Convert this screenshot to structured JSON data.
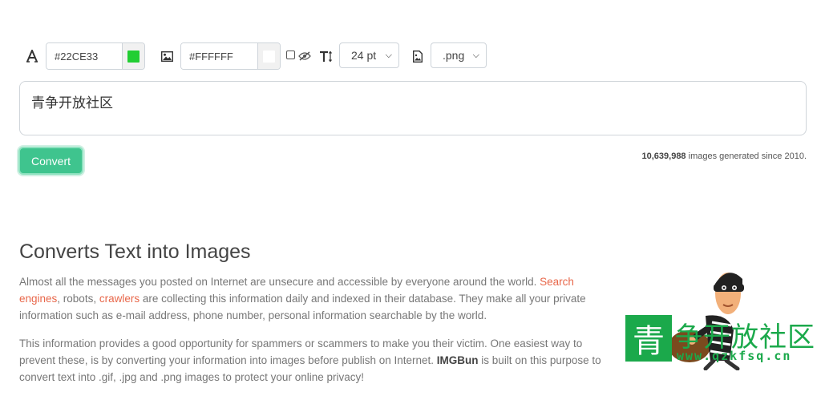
{
  "toolbar": {
    "text_color_value": "#22CE33",
    "text_color_swatch": "#22CE33",
    "bg_color_value": "#FFFFFF",
    "bg_color_swatch": "#FFFFFF",
    "font_size": "24 pt",
    "format": ".png",
    "icons": {
      "font": "font-letter-icon",
      "image": "image-icon",
      "transparent": "eye-slash-icon",
      "text_size": "text-height-icon",
      "file": "file-image-icon"
    }
  },
  "editor": {
    "text": "青争开放社区"
  },
  "convert_label": "Convert",
  "stats": {
    "count": "10,639,988",
    "suffix": " images generated since 2010."
  },
  "content": {
    "heading": "Converts Text into Images",
    "p1_a": "Almost all the messages you posted on Internet are unsecure and accessible by everyone around the world. ",
    "p1_link1": "Search engines",
    "p1_b": ", robots, ",
    "p1_link2": "crawlers",
    "p1_c": " are collecting this information daily and indexed in their database. They make all your private information such as e-mail address, phone number, personal information searchable by the world.",
    "p2_a": "This information provides a good opportunity for spammers or scammers to make you their victim. One easiest way to prevent these, is by converting your information into images before publish on Internet. ",
    "p2_brand": "IMGBun",
    "p2_b": " is built on this purpose to convert text into .gif, .jpg and .png images to protect your online privacy!"
  },
  "watermark": {
    "box_char": "青",
    "text": "争开放社区",
    "url": "www.qzkfsq.cn"
  },
  "colors": {
    "accent": "#3fc48e",
    "link": "#e8674a",
    "watermark": "#1ba94b"
  }
}
